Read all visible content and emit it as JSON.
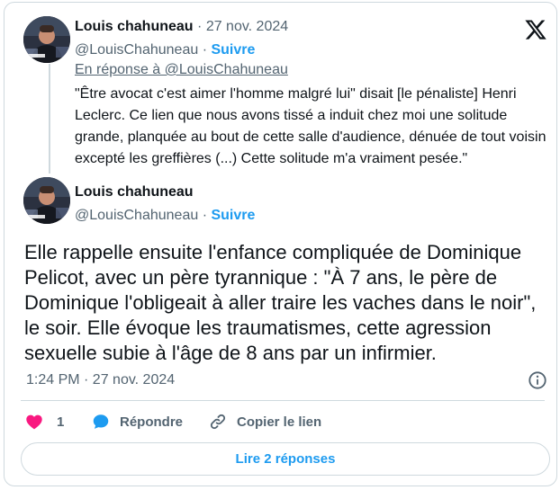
{
  "parent_tweet": {
    "author_name": "Louis chahuneau",
    "separator": "·",
    "date": "27 nov. 2024",
    "handle": "@LouisChahuneau",
    "follow_separator": "·",
    "follow_label": "Suivre",
    "reply_to": "En réponse à @LouisChahuneau",
    "text": "\"Être avocat c'est aimer l'homme malgré lui\" disait [le pénaliste] Henri Leclerc. Ce lien que nous avons tissé a induit chez moi une solitude grande, planquée au bout de cette salle d'audience, dénuée de tout voisin excepté les greffières (...) Cette solitude m'a vraiment pesée.\""
  },
  "main_tweet": {
    "author_name": "Louis chahuneau",
    "handle": "@LouisChahuneau",
    "follow_separator": "·",
    "follow_label": "Suivre",
    "text": "Elle rappelle ensuite l'enfance compliquée de Dominique Pelicot, avec un père tyrannique : \"À 7 ans, le père de Dominique l'obligeait à aller traire les vaches dans le noir\", le soir. Elle évoque les traumatismes, cette agression sexuelle subie à l'âge de 8 ans par un infirmier.",
    "time": "1:24 PM · 27 nov. 2024"
  },
  "actions": {
    "like_count": "1",
    "reply_label": "Répondre",
    "copy_link_label": "Copier le lien"
  },
  "replies_button": "Lire 2 réponses",
  "avatar_caption": "PARIS 7",
  "colors": {
    "accent": "#1d9bf0",
    "like": "#f91880",
    "secondary_text": "#536471",
    "border": "#cfd9de"
  },
  "icons": [
    "x-logo-icon",
    "info-icon",
    "heart-icon",
    "reply-bubble-icon",
    "link-icon"
  ]
}
